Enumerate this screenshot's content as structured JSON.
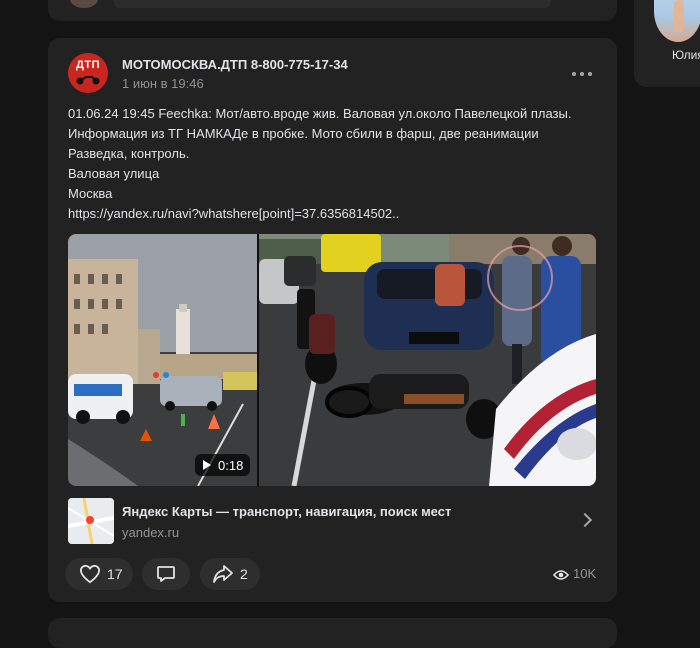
{
  "colors": {
    "background": "#141414",
    "card": "#222222",
    "button": "#2e2e2e",
    "text_primary": "#e1e3e6",
    "text_secondary": "#939393",
    "brand_red": "#c8261f"
  },
  "right_panel": {
    "friend_name": "Юлия"
  },
  "post": {
    "avatar_text": "ДТП",
    "author": "МОТОМОСКВА.ДТП 8-800-775-17-34",
    "date": "1 июн в 19:46",
    "more_icon": "more-horizontal-icon",
    "text_lines": [
      "01.06.24 19:45 Feechka: Мот/авто.вроде жив. Валовая ул.около Павелецкой плазы.",
      "Информация из ТГ НАМКАДе в пробке. Мото сбили в фарш, две реанимации",
      "Разведка, контроль.",
      "Валовая улица",
      "Москва",
      "https://yandex.ru/navi?whatshere[point]=37.6356814502.."
    ],
    "video_duration": "0:18",
    "link": {
      "title": "Яндекс Карты — транспорт, навигация, поиск мест",
      "domain": "yandex.ru"
    },
    "actions": {
      "likes": "17",
      "shares": "2",
      "views": "10K"
    }
  }
}
